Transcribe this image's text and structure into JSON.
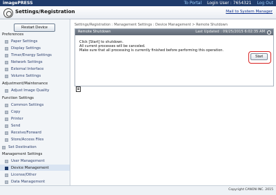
{
  "app": {
    "brand": "imagePRESS",
    "title": "Settings/Registration"
  },
  "topbar": {
    "to_portal": "To Portal",
    "login_user_label": "Login User :",
    "login_user": "7654321",
    "logout": "Log Out"
  },
  "header": {
    "mail_to_admin": "Mail to System Manager"
  },
  "sidebar": {
    "restart_button": "Restart Device",
    "sections": [
      {
        "title": "Preferences",
        "items": [
          "Paper Settings",
          "Display Settings",
          "Timer/Energy Settings",
          "Network Settings",
          "External Interface",
          "Volume Settings"
        ]
      },
      {
        "title": "Adjustment/Maintenance",
        "items": [
          "Adjust Image Quality"
        ]
      },
      {
        "title": "Function Settings",
        "items": [
          "Common Settings",
          "Copy",
          "Printer",
          "Send",
          "Receive/Forward",
          "Store/Access Files"
        ]
      },
      {
        "title": "Set Destination",
        "items": []
      },
      {
        "title": "Management Settings",
        "items": [
          "User Management",
          "Device Management",
          "License/Other",
          "Data Management"
        ]
      }
    ],
    "selected_item": "Device Management"
  },
  "main": {
    "breadcrumb": "Settings/Registration : Management Settings : Device Management > Remote Shutdown",
    "panel": {
      "title": "Remote Shutdown",
      "last_updated": "Last Updated : 09/25/2015 6:02:35 AM",
      "message_lines": [
        "Click [Start] to shutdown.",
        "All current processes will be canceled.",
        "Make sure that all processing is currently finished before performing this operation."
      ],
      "start_button": "Start"
    }
  },
  "footer": {
    "copyright": "Copyright CANON INC. 2015"
  }
}
